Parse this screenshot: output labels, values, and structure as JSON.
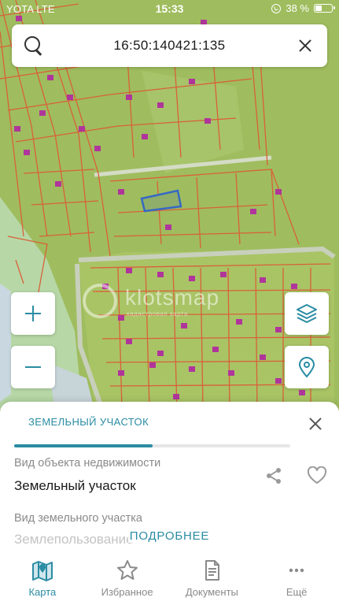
{
  "status_bar": {
    "carrier": "YOTA  LTE",
    "time": "15:33",
    "battery": "38 %"
  },
  "map_tint": "#9fbd5e",
  "search": {
    "value": "16:50:140421:135"
  },
  "watermark": {
    "text": "klotsmap",
    "subtext": "кадастровая карта"
  },
  "sheet": {
    "tab_title": "ЗЕМЕЛЬНЫЙ УЧАСТОК",
    "tab_progress": 0.5,
    "fields": [
      {
        "label": "Вид объекта недвижимости",
        "value": "Земельный участок"
      },
      {
        "label": "Вид земельного участка",
        "value": "Землепользование"
      }
    ],
    "more_label": "ПОДРОБНЕЕ"
  },
  "nav": {
    "items": [
      {
        "label": "Карта",
        "icon": "map-icon",
        "active": true
      },
      {
        "label": "Избранное",
        "icon": "star-icon",
        "active": false
      },
      {
        "label": "Документы",
        "icon": "document-icon",
        "active": false
      },
      {
        "label": "Ещё",
        "icon": "more-dots-icon",
        "active": false
      }
    ]
  },
  "colors": {
    "accent": "#2a8ca3",
    "parcel_line": "#d8613a",
    "building": "#b0359b",
    "selected_parcel": "#3569c4"
  }
}
